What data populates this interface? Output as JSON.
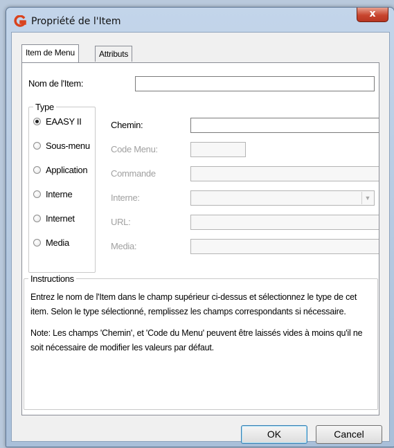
{
  "window": {
    "title": "Propriété de l'Item",
    "close_label": "x"
  },
  "tabs": [
    {
      "label": "Item de Menu",
      "active": true
    },
    {
      "label": "Attributs",
      "active": false
    }
  ],
  "item_name": {
    "label": "Nom de l'Item:",
    "value": ""
  },
  "type_group": {
    "legend": "Type",
    "options": [
      {
        "label": "EAASY II",
        "checked": true
      },
      {
        "label": "Sous-menu",
        "checked": false
      },
      {
        "label": "Application",
        "checked": false
      },
      {
        "label": "Interne",
        "checked": false
      },
      {
        "label": "Internet",
        "checked": false
      },
      {
        "label": "Media",
        "checked": false
      }
    ]
  },
  "fields": [
    {
      "label": "Chemin:",
      "value": "",
      "enabled": true
    },
    {
      "label": "Code Menu:",
      "value": "",
      "enabled": false
    },
    {
      "label": "Commande",
      "value": "",
      "enabled": false
    },
    {
      "label": "Interne:",
      "value": "",
      "enabled": false,
      "kind": "dropdown"
    },
    {
      "label": "URL:",
      "value": "",
      "enabled": false
    },
    {
      "label": "Media:",
      "value": "",
      "enabled": false
    }
  ],
  "instructions": {
    "legend": "Instructions",
    "paragraph1": "Entrez le nom de l'Item dans le champ supérieur ci-dessus et sélectionnez le type de cet item.  Selon le type sélectionné, remplissez les champs correspondants si nécessaire.",
    "paragraph2": "Note: Les champs 'Chemin', et 'Code du Menu' peuvent être laissés vides à moins qu'il ne soit nécessaire de modifier les valeurs par défaut."
  },
  "buttons": {
    "ok": "OK",
    "cancel": "Cancel"
  },
  "colors": {
    "app_icon": "#d9431e",
    "close_button": "#c8452e",
    "default_button_border": "#3c7fb1"
  }
}
